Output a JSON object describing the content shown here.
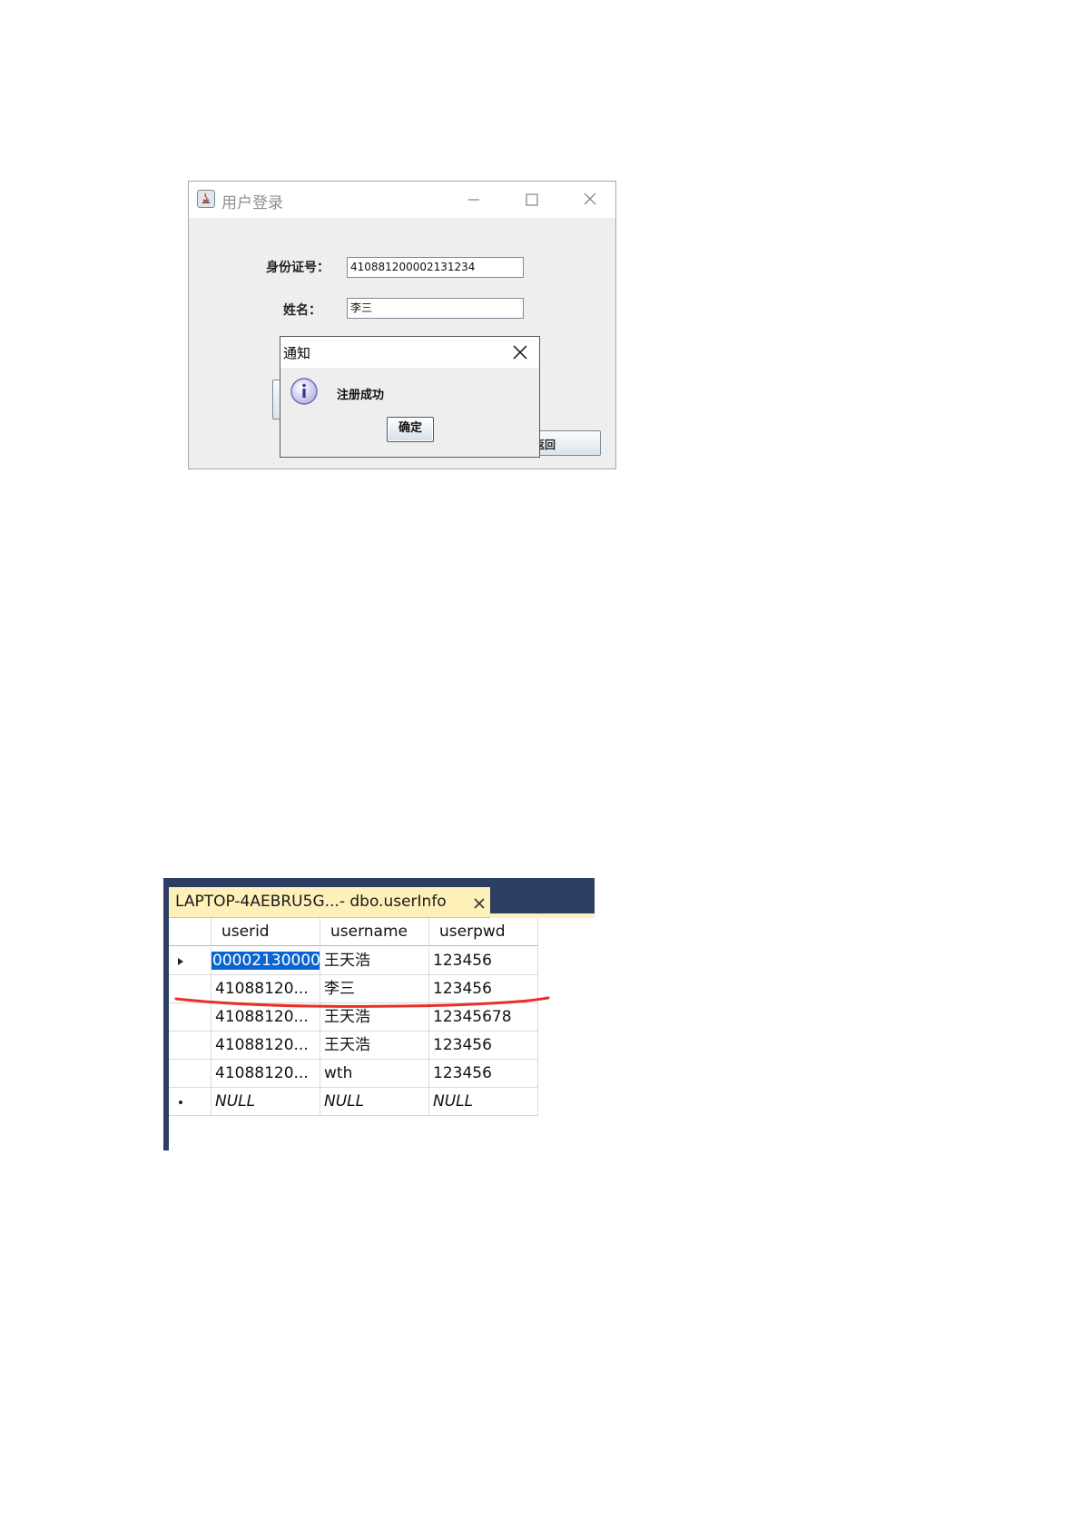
{
  "login_window": {
    "title": "用户登录",
    "id_label": "身份证号：",
    "id_value": "410881200002131234",
    "name_label": "姓名：",
    "name_value": "李三",
    "back_button_label": "返回"
  },
  "notice_dialog": {
    "title": "通知",
    "message": "注册成功",
    "ok_label": "确定"
  },
  "db_grid": {
    "tab_title": "LAPTOP-4AEBRU5G...- dbo.userInfo",
    "columns": [
      "userid",
      "username",
      "userpwd"
    ],
    "rows": [
      {
        "userid": "00002130000",
        "username": "王天浩",
        "userpwd": "123456"
      },
      {
        "userid": "41088120...",
        "username": "李三",
        "userpwd": "123456"
      },
      {
        "userid": "41088120...",
        "username": "王天浩",
        "userpwd": "12345678"
      },
      {
        "userid": "41088120...",
        "username": "王天浩",
        "userpwd": "123456"
      },
      {
        "userid": "41088120...",
        "username": "wth",
        "userpwd": "123456"
      }
    ],
    "new_row": {
      "userid": "NULL",
      "username": "NULL",
      "userpwd": "NULL"
    }
  },
  "colors": {
    "ssms_navy": "#2c3e63",
    "ssms_tab": "#fdf0b8",
    "selection": "#0a64d2",
    "annotation_red": "#e8302a",
    "java_bg": "#eeeeee"
  }
}
